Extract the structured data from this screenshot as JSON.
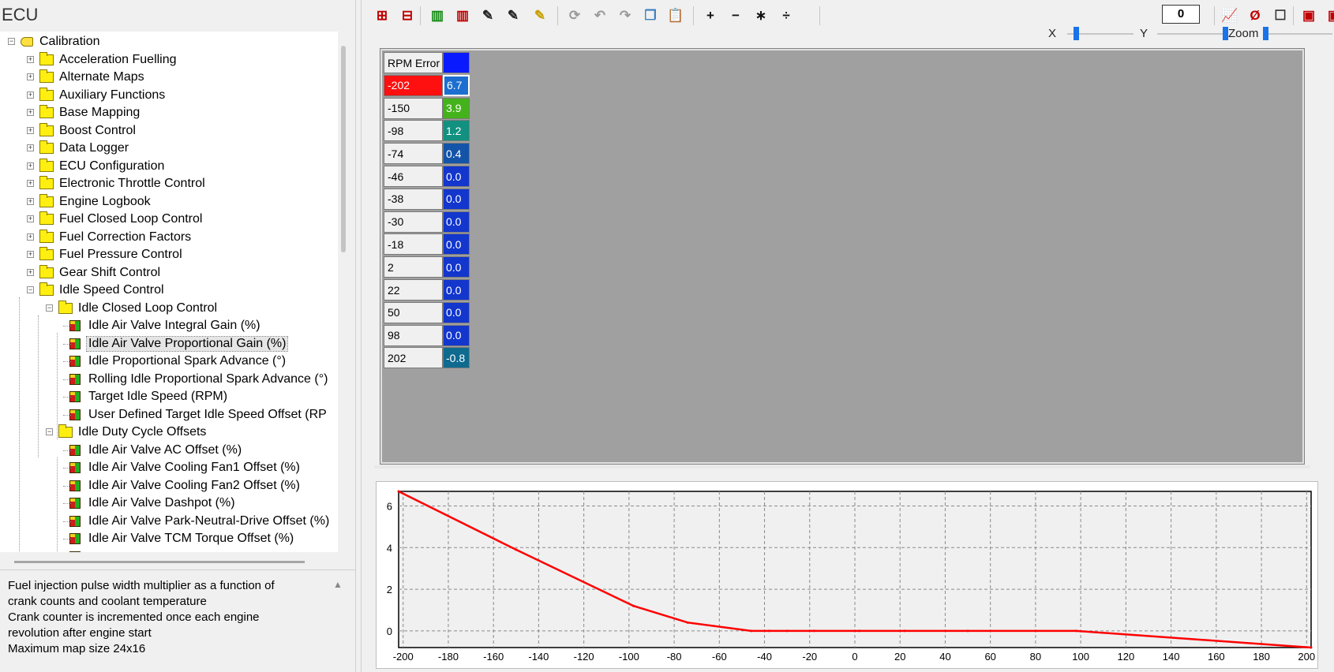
{
  "left_panel": {
    "title": "ECU",
    "tree": [
      {
        "label": "Calibration",
        "type": "root",
        "level": 0,
        "expanded": true
      },
      {
        "label": "Acceleration Fuelling",
        "type": "folder",
        "level": 1,
        "expanded": false
      },
      {
        "label": "Alternate Maps",
        "type": "folder",
        "level": 1,
        "expanded": false
      },
      {
        "label": "Auxiliary Functions",
        "type": "folder",
        "level": 1,
        "expanded": false
      },
      {
        "label": "Base Mapping",
        "type": "folder",
        "level": 1,
        "expanded": false
      },
      {
        "label": "Boost Control",
        "type": "folder",
        "level": 1,
        "expanded": false
      },
      {
        "label": "Data Logger",
        "type": "folder",
        "level": 1,
        "expanded": false
      },
      {
        "label": "ECU Configuration",
        "type": "folder",
        "level": 1,
        "expanded": false
      },
      {
        "label": "Electronic Throttle Control",
        "type": "folder",
        "level": 1,
        "expanded": false
      },
      {
        "label": "Engine Logbook",
        "type": "folder",
        "level": 1,
        "expanded": false
      },
      {
        "label": "Fuel Closed Loop Control",
        "type": "folder",
        "level": 1,
        "expanded": false
      },
      {
        "label": "Fuel Correction Factors",
        "type": "folder",
        "level": 1,
        "expanded": false
      },
      {
        "label": "Fuel Pressure Control",
        "type": "folder",
        "level": 1,
        "expanded": false
      },
      {
        "label": "Gear Shift Control",
        "type": "folder",
        "level": 1,
        "expanded": false
      },
      {
        "label": "Idle Speed Control",
        "type": "folder",
        "level": 1,
        "expanded": true
      },
      {
        "label": "Idle Closed Loop Control",
        "type": "folder",
        "level": 2,
        "expanded": true
      },
      {
        "label": "Idle Air Valve Integral Gain (%)",
        "type": "map",
        "level": 3
      },
      {
        "label": "Idle Air Valve Proportional Gain (%)",
        "type": "map",
        "level": 3,
        "selected": true
      },
      {
        "label": "Idle Proportional Spark Advance (°)",
        "type": "map",
        "level": 3
      },
      {
        "label": "Rolling Idle Proportional Spark Advance (°)",
        "type": "map",
        "level": 3
      },
      {
        "label": "Target Idle Speed (RPM)",
        "type": "map",
        "level": 3
      },
      {
        "label": "User Defined Target Idle Speed Offset (RP",
        "type": "map",
        "level": 3
      },
      {
        "label": "Idle Duty Cycle Offsets",
        "type": "folder",
        "level": 2,
        "expanded": true
      },
      {
        "label": "Idle Air Valve AC Offset (%)",
        "type": "map",
        "level": 3
      },
      {
        "label": "Idle Air Valve Cooling Fan1 Offset (%)",
        "type": "map",
        "level": 3
      },
      {
        "label": "Idle Air Valve Cooling Fan2 Offset (%)",
        "type": "map",
        "level": 3
      },
      {
        "label": "Idle Air Valve Dashpot (%)",
        "type": "map",
        "level": 3
      },
      {
        "label": "Idle Air Valve Park-Neutral-Drive Offset (%)",
        "type": "map",
        "level": 3
      },
      {
        "label": "Idle Air Valve TCM Torque Offset (%)",
        "type": "map",
        "level": 3
      },
      {
        "label": "",
        "type": "map",
        "level": 3
      }
    ],
    "description": [
      "Fuel injection pulse width multiplier as a function of",
      "crank counts and coolant temperature",
      "Crank counter is incremented once each engine",
      "revolution after engine start",
      "Maximum map size 24x16"
    ]
  },
  "toolbar": {
    "buttons": [
      {
        "name": "insert-row-icon",
        "glyph": "⊞",
        "color": "#c00000"
      },
      {
        "name": "delete-row-icon",
        "glyph": "⊟",
        "color": "#c00000"
      },
      {
        "name": "insert-column-icon",
        "glyph": "▥",
        "color": "#108a10"
      },
      {
        "name": "delete-column-icon",
        "glyph": "▥",
        "color": "#c00000"
      },
      {
        "name": "edit-axis-icon",
        "glyph": "✎",
        "color": "#222222"
      },
      {
        "name": "edit-axis-alt-icon",
        "glyph": "✎",
        "color": "#222222"
      },
      {
        "name": "highlighter-icon",
        "glyph": "✎",
        "color": "#c8a000"
      },
      {
        "name": "refresh-icon",
        "glyph": "⟳",
        "color": "#9a9a9a"
      },
      {
        "name": "undo-icon",
        "glyph": "↶",
        "color": "#9a9a9a"
      },
      {
        "name": "redo-icon",
        "glyph": "↷",
        "color": "#9a9a9a"
      },
      {
        "name": "copy-icon",
        "glyph": "❐",
        "color": "#3a7fc0"
      },
      {
        "name": "paste-icon",
        "glyph": "📋",
        "color": "#3a7fc0"
      },
      {
        "name": "add-icon",
        "glyph": "+",
        "color": "#111111"
      },
      {
        "name": "subtract-icon",
        "glyph": "−",
        "color": "#111111"
      },
      {
        "name": "multiply-icon",
        "glyph": "∗",
        "color": "#111111"
      },
      {
        "name": "divide-icon",
        "glyph": "÷",
        "color": "#111111"
      },
      {
        "name": "graph-icon",
        "glyph": "📈",
        "color": "#c00000"
      },
      {
        "name": "clear-graph-icon",
        "glyph": "Ø",
        "color": "#c00000"
      },
      {
        "name": "checkbox-icon",
        "glyph": "☐",
        "color": "#333333"
      },
      {
        "name": "map-3d-icon",
        "glyph": "▣",
        "color": "#c00000"
      },
      {
        "name": "map-export-icon",
        "glyph": "▣",
        "color": "#c00000"
      }
    ],
    "operand_value": "0",
    "slider_labels": {
      "x": "X",
      "y": "Y",
      "zoom": "Zoom"
    },
    "slider_values": {
      "x": 0.1,
      "y": 1.0,
      "zoom": 0.0
    }
  },
  "table": {
    "axis_header": "RPM Error",
    "rows": [
      {
        "rpm": "-202",
        "value": "6.7",
        "color": "#1c6fd0"
      },
      {
        "rpm": "-150",
        "value": "3.9",
        "color": "#44b21a"
      },
      {
        "rpm": "-98",
        "value": "1.2",
        "color": "#129080"
      },
      {
        "rpm": "-74",
        "value": "0.4",
        "color": "#1454a8"
      },
      {
        "rpm": "-46",
        "value": "0.0",
        "color": "#1336cc"
      },
      {
        "rpm": "-38",
        "value": "0.0",
        "color": "#1336cc"
      },
      {
        "rpm": "-30",
        "value": "0.0",
        "color": "#1336cc"
      },
      {
        "rpm": "-18",
        "value": "0.0",
        "color": "#1336cc"
      },
      {
        "rpm": "2",
        "value": "0.0",
        "color": "#1336cc"
      },
      {
        "rpm": "22",
        "value": "0.0",
        "color": "#1336cc"
      },
      {
        "rpm": "50",
        "value": "0.0",
        "color": "#1336cc"
      },
      {
        "rpm": "98",
        "value": "0.0",
        "color": "#1336cc"
      },
      {
        "rpm": "202",
        "value": "-0.8",
        "color": "#0f6a8f"
      }
    ],
    "header_value_color": "#0a1aff",
    "selected_row_color": "#ff1010"
  },
  "chart_data": {
    "type": "line",
    "title": "",
    "xlabel": "",
    "ylabel": "",
    "x": [
      -202,
      -150,
      -98,
      -74,
      -46,
      -38,
      -30,
      -18,
      2,
      22,
      50,
      98,
      202
    ],
    "series": [
      {
        "values": [
          6.7,
          3.9,
          1.2,
          0.4,
          0.0,
          0.0,
          0.0,
          0.0,
          0.0,
          0.0,
          0.0,
          0.0,
          -0.8
        ],
        "color": "#ff0000"
      }
    ],
    "xlim": [
      -202,
      202
    ],
    "ylim": [
      -0.8,
      6.7
    ],
    "xticks": [
      -200,
      -180,
      -160,
      -140,
      -120,
      -100,
      -80,
      -60,
      -40,
      -20,
      0,
      20,
      40,
      60,
      80,
      100,
      120,
      140,
      160,
      180,
      200
    ],
    "yticks": [
      0,
      2,
      4,
      6
    ],
    "grid": true
  }
}
